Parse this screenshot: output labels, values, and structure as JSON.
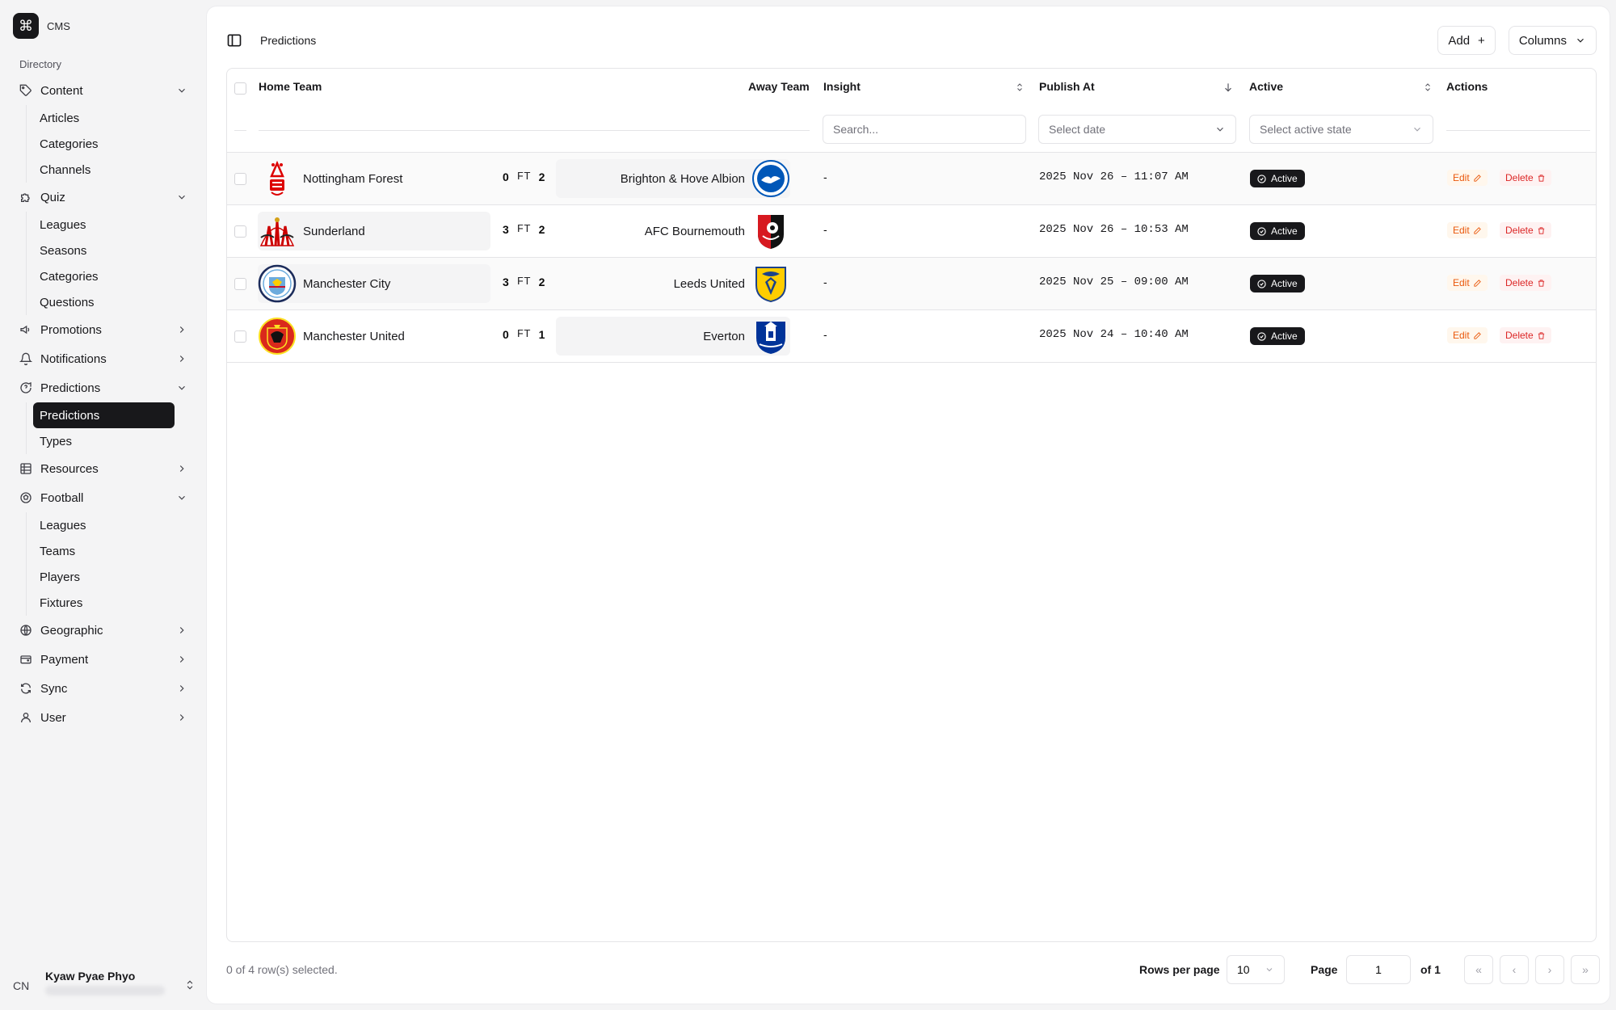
{
  "app": {
    "name": "CMS"
  },
  "sidebar": {
    "directory_label": "Directory",
    "groups": [
      {
        "label": "Content",
        "icon": "tag-icon",
        "expanded": true,
        "items": [
          "Articles",
          "Categories",
          "Channels"
        ]
      },
      {
        "label": "Quiz",
        "icon": "puzzle-icon",
        "expanded": true,
        "items": [
          "Leagues",
          "Seasons",
          "Categories",
          "Questions"
        ]
      },
      {
        "label": "Promotions",
        "icon": "megaphone-icon",
        "expanded": false,
        "items": []
      },
      {
        "label": "Notifications",
        "icon": "bell-icon",
        "expanded": false,
        "items": []
      },
      {
        "label": "Predictions",
        "icon": "message-question-icon",
        "expanded": true,
        "items": [
          "Predictions",
          "Types"
        ],
        "active_item": "Predictions"
      },
      {
        "label": "Resources",
        "icon": "table-icon",
        "expanded": false,
        "items": []
      },
      {
        "label": "Football",
        "icon": "football-icon",
        "expanded": true,
        "items": [
          "Leagues",
          "Teams",
          "Players",
          "Fixtures"
        ]
      },
      {
        "label": "Geographic",
        "icon": "globe-icon",
        "expanded": false,
        "items": []
      },
      {
        "label": "Payment",
        "icon": "wallet-icon",
        "expanded": false,
        "items": []
      },
      {
        "label": "Sync",
        "icon": "refresh-icon",
        "expanded": false,
        "items": []
      },
      {
        "label": "User",
        "icon": "user-icon",
        "expanded": false,
        "items": []
      }
    ],
    "user": {
      "initials": "CN",
      "name": "Kyaw Pyae Phyo"
    }
  },
  "header": {
    "breadcrumb": "Predictions",
    "add_label": "Add",
    "columns_label": "Columns"
  },
  "table": {
    "columns": {
      "home": "Home Team",
      "away": "Away Team",
      "insight": "Insight",
      "publish": "Publish At",
      "active": "Active",
      "actions": "Actions"
    },
    "filters": {
      "insight_placeholder": "Search...",
      "date_placeholder": "Select date",
      "active_placeholder": "Select active state"
    },
    "rows": [
      {
        "home": "Nottingham Forest",
        "home_score": "0",
        "status": "FT",
        "away_score": "2",
        "away": "Brighton & Hove Albion",
        "insight": "-",
        "publish_at": "2025 Nov 26 – 11:07 AM",
        "active": "Active",
        "edit": "Edit",
        "delete": "Delete"
      },
      {
        "home": "Sunderland",
        "home_score": "3",
        "status": "FT",
        "away_score": "2",
        "away": "AFC Bournemouth",
        "insight": "-",
        "publish_at": "2025 Nov 26 – 10:53 AM",
        "active": "Active",
        "edit": "Edit",
        "delete": "Delete"
      },
      {
        "home": "Manchester City",
        "home_score": "3",
        "status": "FT",
        "away_score": "2",
        "away": "Leeds United",
        "insight": "-",
        "publish_at": "2025 Nov 25 – 09:00 AM",
        "active": "Active",
        "edit": "Edit",
        "delete": "Delete"
      },
      {
        "home": "Manchester United",
        "home_score": "0",
        "status": "FT",
        "away_score": "1",
        "away": "Everton",
        "insight": "-",
        "publish_at": "2025 Nov 24 – 10:40 AM",
        "active": "Active",
        "edit": "Edit",
        "delete": "Delete"
      }
    ]
  },
  "footer": {
    "selection": "0 of 4 row(s) selected.",
    "rows_per_page_label": "Rows per page",
    "rows_per_page": "10",
    "page_label": "Page",
    "page": "1",
    "of_label": "of 1"
  },
  "colors": {
    "accent": "#18181b",
    "edit": "#ea580c",
    "delete": "#dc2626"
  }
}
